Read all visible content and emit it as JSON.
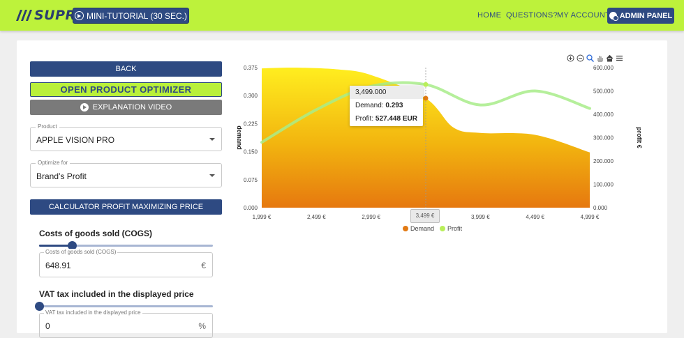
{
  "header": {
    "logo_text": "SUPRA",
    "tutorial_label": "MINI-TUTORIAL (30 SEC.)",
    "nav": [
      "HOME",
      "QUESTIONS?",
      "MY ACCOUNT"
    ],
    "admin_label": "ADMIN PANEL",
    "accent_color": "#bdf23b",
    "brand_color": "#2e4a82"
  },
  "sidebar": {
    "back_label": "BACK",
    "optimizer_label": "OPEN PRODUCT OPTIMIZER",
    "video_label": "EXPLANATION VIDEO",
    "product": {
      "label": "Product",
      "value": "APPLE VISION PRO"
    },
    "optimize_for": {
      "label": "Optimize for",
      "value": "Brand’s Profit"
    },
    "calc_label": "CALCULATOR PROFIT MAXIMIZING PRICE",
    "cogs": {
      "title": "Costs of goods sold (COGS)",
      "field_label": "Costs of goods sold (COGS)",
      "value": "648.91",
      "unit": "€",
      "slider_fraction": 0.19
    },
    "vat": {
      "title": "VAT tax included in the displayed price",
      "field_label": "VAT tax included in the displayed price",
      "value": "0",
      "unit": "%",
      "slider_fraction": 0.0
    }
  },
  "chart_data": {
    "type": "area",
    "x": [
      "1,999 €",
      "2,499 €",
      "2,999 €",
      "3,499 €",
      "3,999 €",
      "4,499 €",
      "4,999 €"
    ],
    "x_values": [
      1999,
      2499,
      2999,
      3499,
      3999,
      4499,
      4999
    ],
    "ylabel": "demand",
    "y2label": "profit €",
    "yticks": [
      "0.000",
      "0.075",
      "0.150",
      "0.225",
      "0.300",
      "0.375"
    ],
    "y2ticks": [
      "0.000",
      "100.000",
      "200.000",
      "300.000",
      "400.000",
      "500.000",
      "600.000"
    ],
    "ylim": [
      0,
      0.375
    ],
    "y2lim": [
      0,
      600000
    ],
    "series": [
      {
        "name": "Demand",
        "color": "#e27a14",
        "axis": "left",
        "x": [
          1999,
          2300,
          2700,
          2999,
          3499,
          3750,
          3999,
          4499,
          4999
        ],
        "values": [
          0.373,
          0.375,
          0.37,
          0.355,
          0.293,
          0.215,
          0.2,
          0.195,
          0.148
        ]
      },
      {
        "name": "Profit",
        "color": "#b9ef5a",
        "axis": "right",
        "x": [
          1999,
          2499,
          2999,
          3499,
          3999,
          4499,
          4999
        ],
        "values": [
          280000,
          420000,
          520000,
          527448,
          440000,
          500000,
          425000
        ]
      }
    ],
    "tooltip": {
      "header": "3,499.000",
      "demand_label": "Demand:",
      "demand_value": "0.293",
      "profit_label": "Profit:",
      "profit_value": "527.448 EUR"
    },
    "crosshair_label": "3,499 €",
    "legend": [
      "Demand",
      "Profit"
    ],
    "legend_placement": "bottom-center",
    "grid": false
  }
}
